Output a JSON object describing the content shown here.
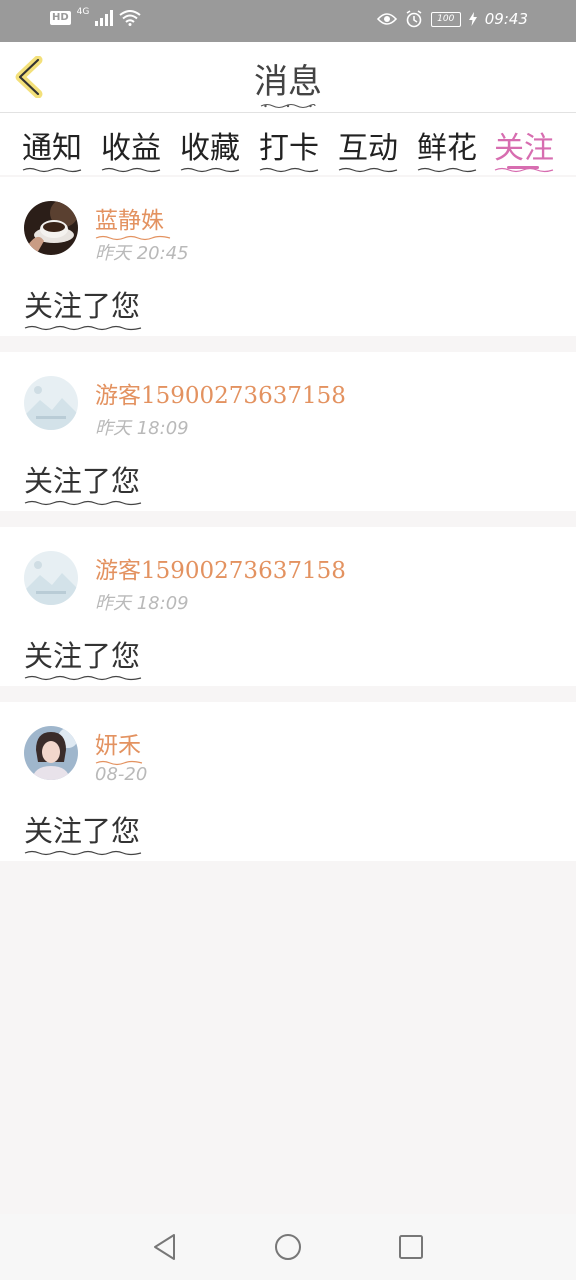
{
  "status_bar": {
    "hd": "HD",
    "network": "4G",
    "battery": "100",
    "time": "09:43"
  },
  "header": {
    "title": "消息",
    "back_icon": "chevron-left-icon"
  },
  "tabs": [
    {
      "label": "通知",
      "active": false
    },
    {
      "label": "收益",
      "active": false
    },
    {
      "label": "收藏",
      "active": false
    },
    {
      "label": "打卡",
      "active": false
    },
    {
      "label": "互动",
      "active": false
    },
    {
      "label": "鲜花",
      "active": false
    },
    {
      "label": "关注",
      "active": true
    }
  ],
  "messages": [
    {
      "username": "蓝静姝",
      "time": "昨天  20:45",
      "action": "关注了您",
      "avatar": "coffee-cup-photo"
    },
    {
      "username": "游客15900273637158",
      "time": "昨天  18:09",
      "action": "关注了您",
      "avatar": "default-landscape-avatar"
    },
    {
      "username": "游客15900273637158",
      "time": "昨天  18:09",
      "action": "关注了您",
      "avatar": "default-landscape-avatar"
    },
    {
      "username": "妍禾",
      "time": "08-20",
      "action": "关注了您",
      "avatar": "portrait-photo"
    }
  ],
  "nav": {
    "back": "triangle-back-icon",
    "home": "circle-home-icon",
    "recents": "square-recents-icon"
  },
  "colors": {
    "accent": "#d76db0",
    "username": "#e39260",
    "status_bar": "#9a9a9a"
  }
}
